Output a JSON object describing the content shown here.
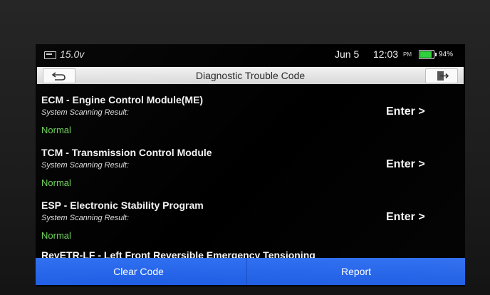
{
  "status_bar": {
    "voltage": "15.0v",
    "date": "Jun 5",
    "time": "12:03",
    "ampm": "PM",
    "battery_percent": "94%",
    "battery_level": 0.94,
    "battery_color": "#2fd13c"
  },
  "header": {
    "title": "Diagnostic Trouble Code",
    "back_icon": "back-arrow-icon",
    "exit_icon": "exit-icon"
  },
  "modules": [
    {
      "name": "ECM - Engine Control Module(ME)",
      "sub_label": "System Scanning Result:",
      "status": "Normal",
      "action": "Enter >"
    },
    {
      "name": "TCM - Transmission Control Module",
      "sub_label": "System Scanning Result:",
      "status": "Normal",
      "action": "Enter >"
    },
    {
      "name": "ESP - Electronic Stability Program",
      "sub_label": "System Scanning Result:",
      "status": "Normal",
      "action": "Enter >"
    },
    {
      "name": "RevETR-LF - Left Front Reversible Emergency Tensioning"
    }
  ],
  "footer": {
    "clear_label": "Clear Code",
    "report_label": "Report",
    "button_color": "#2f6ff0"
  },
  "colors": {
    "status_normal": "#6fd35b"
  }
}
